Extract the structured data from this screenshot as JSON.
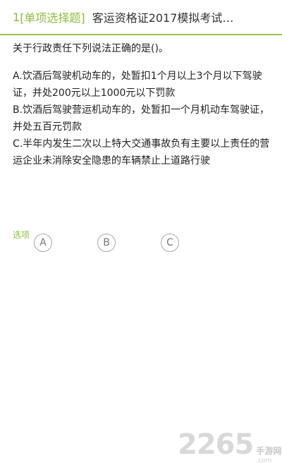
{
  "header": {
    "number": "1",
    "type_label": "[单项选择题]",
    "title": "客运资格证2017模拟考试…"
  },
  "question": {
    "stem": "关于行政责任下列说法正确的是()。"
  },
  "choices": [
    {
      "text": "A.饮酒后驾驶机动车的，处暂扣1个月以上3个月以下驾驶证，并处200元以上1000元以下罚款"
    },
    {
      "text": "B.饮酒后驾驶营运机动车的，处暂扣一个月机动车驾驶证，并处五百元罚款"
    },
    {
      "text": "C.半年内发生二次以上特大交通事故负有主要以上责任的营运企业未消除安全隐患的车辆禁止上道路行驶"
    }
  ],
  "options": {
    "label": "选项",
    "buttons": [
      "A",
      "B",
      "C"
    ]
  },
  "watermark": {
    "number": "2265",
    "cn": "手游网",
    "url": ".com"
  },
  "colors": {
    "accent": "#8cbf3f",
    "divider": "#9fc24a",
    "option_border": "#aaaaaa"
  }
}
